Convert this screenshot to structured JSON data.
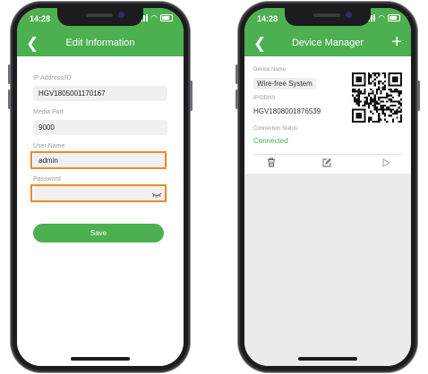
{
  "status_bar": {
    "time": "14:28"
  },
  "edit_screen": {
    "title": "Edit Information",
    "back_icon": "chevron-left-icon",
    "fields": {
      "ip_label": "IP Address/ID",
      "ip_value": "HGV1805001170167",
      "port_label": "Media Port",
      "port_value": "9000",
      "user_label": "User Name",
      "user_value": "admin",
      "password_label": "Password",
      "password_value": ""
    },
    "save_label": "Save",
    "eye_icon": "eye-closed-icon"
  },
  "device_screen": {
    "title": "Device Manager",
    "add_icon": "plus-icon",
    "device_name_label": "Device Name",
    "device_name": "Wire-free System",
    "ipddns_label": "IP/DDNS",
    "ipddns_value": "HGV1808001876539",
    "connection_label": "Connection Status",
    "connection_value": "Connected",
    "actions": [
      "trash-icon",
      "edit-icon",
      "play-icon"
    ]
  },
  "colors": {
    "accent": "#4cb050",
    "highlight": "#f08a24",
    "field_bg": "#f0f0f0"
  }
}
